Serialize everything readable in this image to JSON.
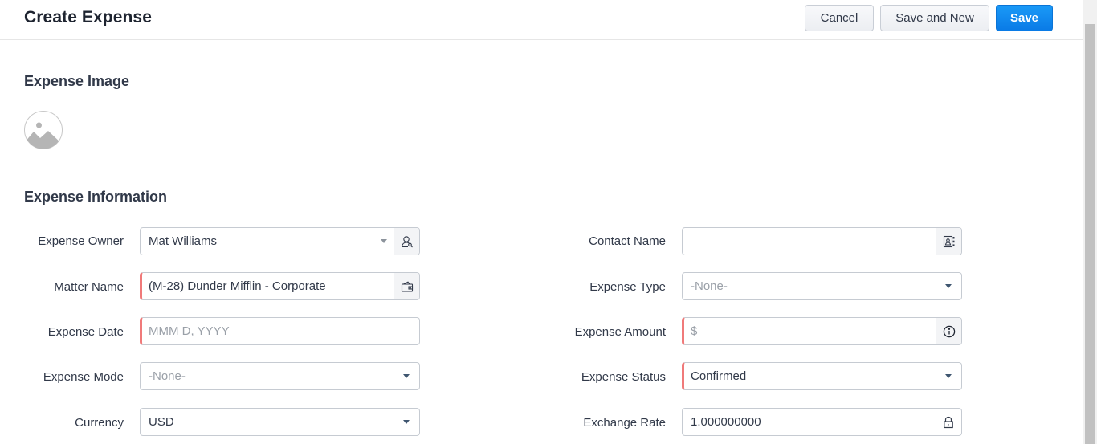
{
  "header": {
    "title": "Create Expense",
    "cancel_label": "Cancel",
    "save_new_label": "Save and New",
    "save_label": "Save"
  },
  "colors": {
    "primary": "#0a7be6",
    "required_marker": "#f07a7a"
  },
  "sections": {
    "image": {
      "title": "Expense Image",
      "icon": "image-placeholder-icon"
    },
    "info": {
      "title": "Expense Information"
    }
  },
  "fields": {
    "expense_owner": {
      "label": "Expense Owner",
      "value": "Mat Williams",
      "icon": "user-search-icon"
    },
    "matter_name": {
      "label": "Matter Name",
      "value": "(M-28) Dunder Mifflin - Corporate",
      "icon": "wallet-icon",
      "required": true
    },
    "expense_date": {
      "label": "Expense Date",
      "placeholder": "MMM D, YYYY",
      "required": true
    },
    "expense_mode": {
      "label": "Expense Mode",
      "value": "-None-"
    },
    "currency": {
      "label": "Currency",
      "value": "USD"
    },
    "contact_name": {
      "label": "Contact Name",
      "value": "",
      "icon": "contact-card-icon"
    },
    "expense_type": {
      "label": "Expense Type",
      "value": "-None-"
    },
    "expense_amount": {
      "label": "Expense Amount",
      "placeholder": "$",
      "icon": "info-icon",
      "required": true
    },
    "expense_status": {
      "label": "Expense Status",
      "value": "Confirmed",
      "required": true
    },
    "exchange_rate": {
      "label": "Exchange Rate",
      "value": "1.000000000",
      "icon": "lock-icon"
    }
  }
}
